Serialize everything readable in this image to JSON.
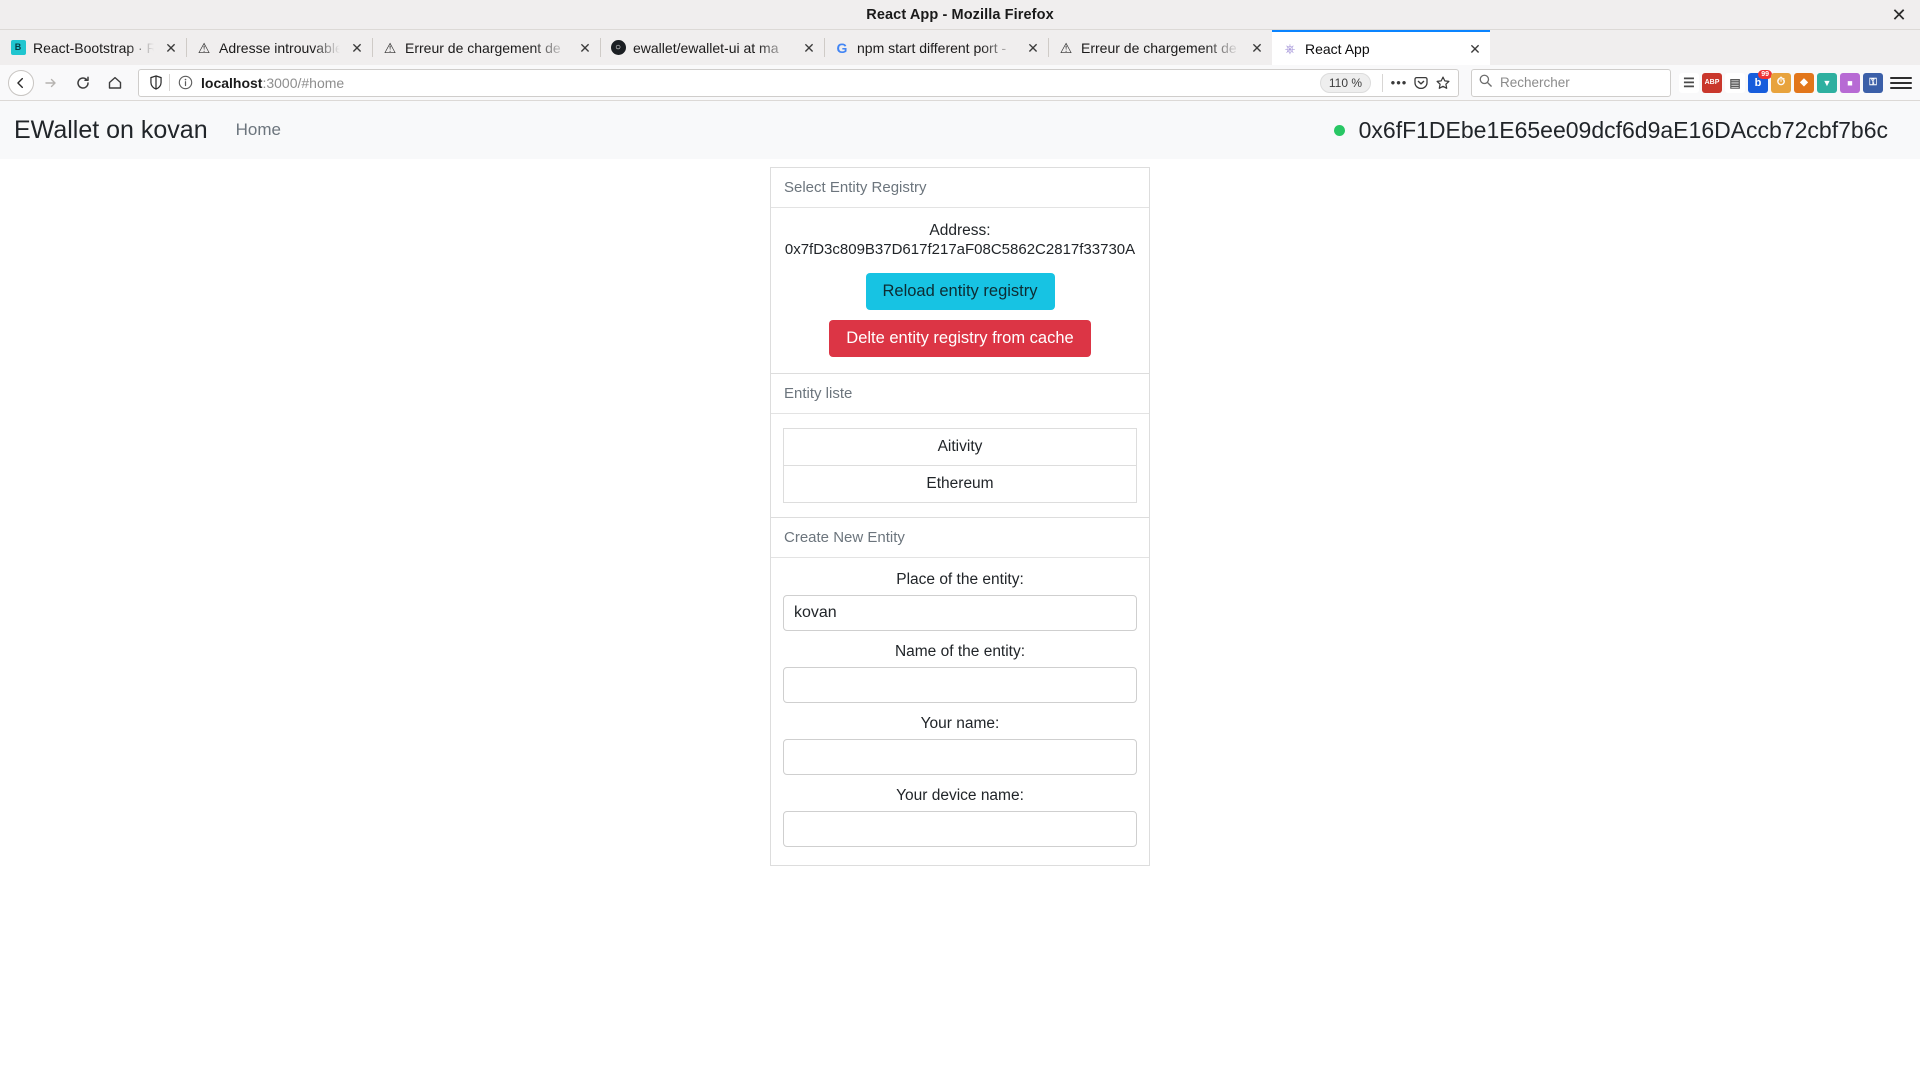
{
  "window": {
    "title": "React App - Mozilla Firefox",
    "close_label": "✕"
  },
  "tabs": [
    {
      "label": "React-Bootstrap · React-",
      "icon": "react-bootstrap-favicon",
      "close": "✕",
      "active": false
    },
    {
      "label": "Adresse introuvable",
      "icon": "warning-favicon",
      "close": "✕",
      "active": false
    },
    {
      "label": "Erreur de chargement de",
      "icon": "warning-favicon",
      "close": "✕",
      "active": false
    },
    {
      "label": "ewallet/ewallet-ui at ma",
      "icon": "github-favicon",
      "close": "✕",
      "active": false
    },
    {
      "label": "npm start different port -",
      "icon": "google-favicon",
      "close": "✕",
      "active": false
    },
    {
      "label": "Erreur de chargement de",
      "icon": "warning-favicon",
      "close": "✕",
      "active": false
    },
    {
      "label": "React App",
      "icon": "react-favicon",
      "close": "✕",
      "active": true
    }
  ],
  "toolbar": {
    "back_icon": "←",
    "forward_icon": "→",
    "reload_icon": "⟳",
    "home_icon": "⌂",
    "shield_icon": "shield-icon",
    "info_icon": "ⓘ",
    "url_host": "localhost",
    "url_path": ":3000/#home",
    "url_full": "localhost:3000/#home",
    "zoom_level": "110 %",
    "more_icon": "•••",
    "pocket_icon": "pocket-icon",
    "bookmark_icon": "☆",
    "library_icon": "library-icon",
    "hamburger_icon": "menu-icon"
  },
  "search": {
    "placeholder": "Rechercher",
    "icon": "search-icon"
  },
  "extensions": [
    {
      "name": "library-icon",
      "label": "≣",
      "color": "#4a4a4a",
      "badge": ""
    },
    {
      "name": "adblock-icon",
      "label": "ABP",
      "color": "#c9372c",
      "badge": ""
    },
    {
      "name": "reader-icon",
      "label": "▤",
      "color": "#5a5a5a",
      "badge": ""
    },
    {
      "name": "bitwarden-icon",
      "label": "b",
      "color": "#175ddc",
      "badge": "99"
    },
    {
      "name": "clock-icon",
      "label": "◴",
      "color": "#e8a33d",
      "badge": ""
    },
    {
      "name": "metamask-icon",
      "label": "◆",
      "color": "#e2761b",
      "badge": ""
    },
    {
      "name": "pocket-ext-icon",
      "label": "▼",
      "color": "#2eb0a0",
      "badge": ""
    },
    {
      "name": "colorzilla-icon",
      "label": "■",
      "color": "#b76ad4",
      "badge": ""
    },
    {
      "name": "keepass-icon",
      "label": "⚿",
      "color": "#3b5fa8",
      "badge": ""
    }
  ],
  "app": {
    "brand": "EWallet on kovan",
    "nav_home": "Home",
    "wallet_status": "connected",
    "wallet_address": "0x6fF1DEbe1E65ee09dcf6d9aE16DAccb72cbf7b6c",
    "accent_green": "#28c764"
  },
  "cards": {
    "registry": {
      "header": "Select Entity Registry",
      "address_label": "Address:",
      "address_value": "0x7fD3c809B37D617f217aF08C5862C2817f33730A",
      "reload_button": "Reload entity registry",
      "reload_color": "#17c3e3",
      "delete_button": "Delte entity registry from cache",
      "delete_color": "#dc3545"
    },
    "entity_list": {
      "header": "Entity liste",
      "items": [
        "Aitivity",
        "Ethereum"
      ]
    },
    "create_entity": {
      "header": "Create New Entity",
      "fields": [
        {
          "label": "Place of the entity:",
          "value": "kovan",
          "placeholder": ""
        },
        {
          "label": "Name of the entity:",
          "value": "",
          "placeholder": ""
        },
        {
          "label": "Your name:",
          "value": "",
          "placeholder": ""
        },
        {
          "label": "Your device name:",
          "value": "",
          "placeholder": ""
        }
      ]
    }
  }
}
